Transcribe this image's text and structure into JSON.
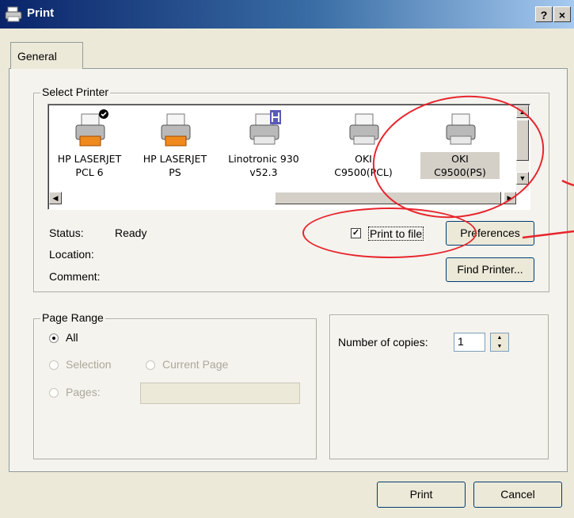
{
  "window": {
    "title": "Print",
    "help_btn": "?",
    "close_btn": "×"
  },
  "tabs": [
    {
      "label": "General"
    }
  ],
  "select_printer": {
    "label": "Select Printer",
    "printers": [
      {
        "name": "HP LASERJET\nPCL 6",
        "default": true
      },
      {
        "name": "HP LASERJET\nPS",
        "default": false
      },
      {
        "name": "Linotronic 930\nv52.3",
        "default": false
      },
      {
        "name": "OKI\nC9500(PCL)",
        "default": false
      },
      {
        "name": "OKI\nC9500(PS)",
        "default": false,
        "selected": true
      }
    ],
    "status_label": "Status:",
    "status_value": "Ready",
    "location_label": "Location:",
    "location_value": "",
    "comment_label": "Comment:",
    "comment_value": "",
    "print_to_file_label": "Print to file",
    "print_to_file_checked": true,
    "preferences_label": "Preferences",
    "find_printer_label": "Find Printer..."
  },
  "page_range": {
    "label": "Page Range",
    "all_label": "All",
    "selection_label": "Selection",
    "current_page_label": "Current Page",
    "pages_label": "Pages:",
    "pages_value": ""
  },
  "copies": {
    "label": "Number of copies:",
    "value": "1"
  },
  "footer": {
    "print_label": "Print",
    "cancel_label": "Cancel"
  },
  "annotation_color": "#e8242c"
}
